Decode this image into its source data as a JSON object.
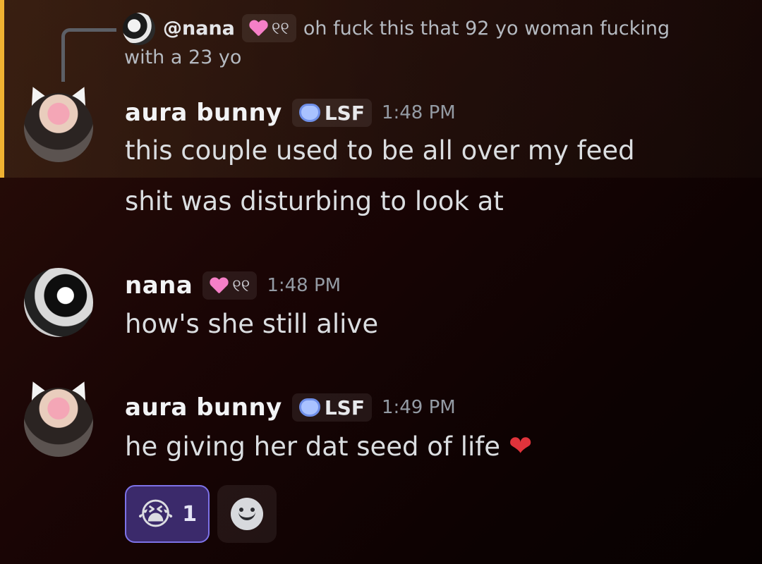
{
  "reply": {
    "author": "@nana",
    "tag_glyph": "୧୧",
    "text_line1": "oh fuck this that 92 yo woman fucking",
    "text_line2": "with a 23 yo"
  },
  "messages": [
    {
      "author": "aura bunny",
      "tag": "LSF",
      "time": "1:48 PM",
      "lines": [
        "this couple used to be all over my feed",
        "shit was disturbing to look at"
      ]
    },
    {
      "author": "nana",
      "tag_glyph": "୧୧",
      "time": "1:48 PM",
      "lines": [
        "how's she still alive"
      ]
    },
    {
      "author": "aura bunny",
      "tag": "LSF",
      "time": "1:49 PM",
      "lines": [
        "he giving her dat seed of life"
      ],
      "trailing_emoji": "❤"
    }
  ],
  "reactions": [
    {
      "emoji": "😭",
      "count": "1"
    }
  ],
  "colors": {
    "highlight_bar": "#f0b232",
    "reaction_active": "#3b2a6b",
    "reaction_border": "#7d72e8"
  }
}
